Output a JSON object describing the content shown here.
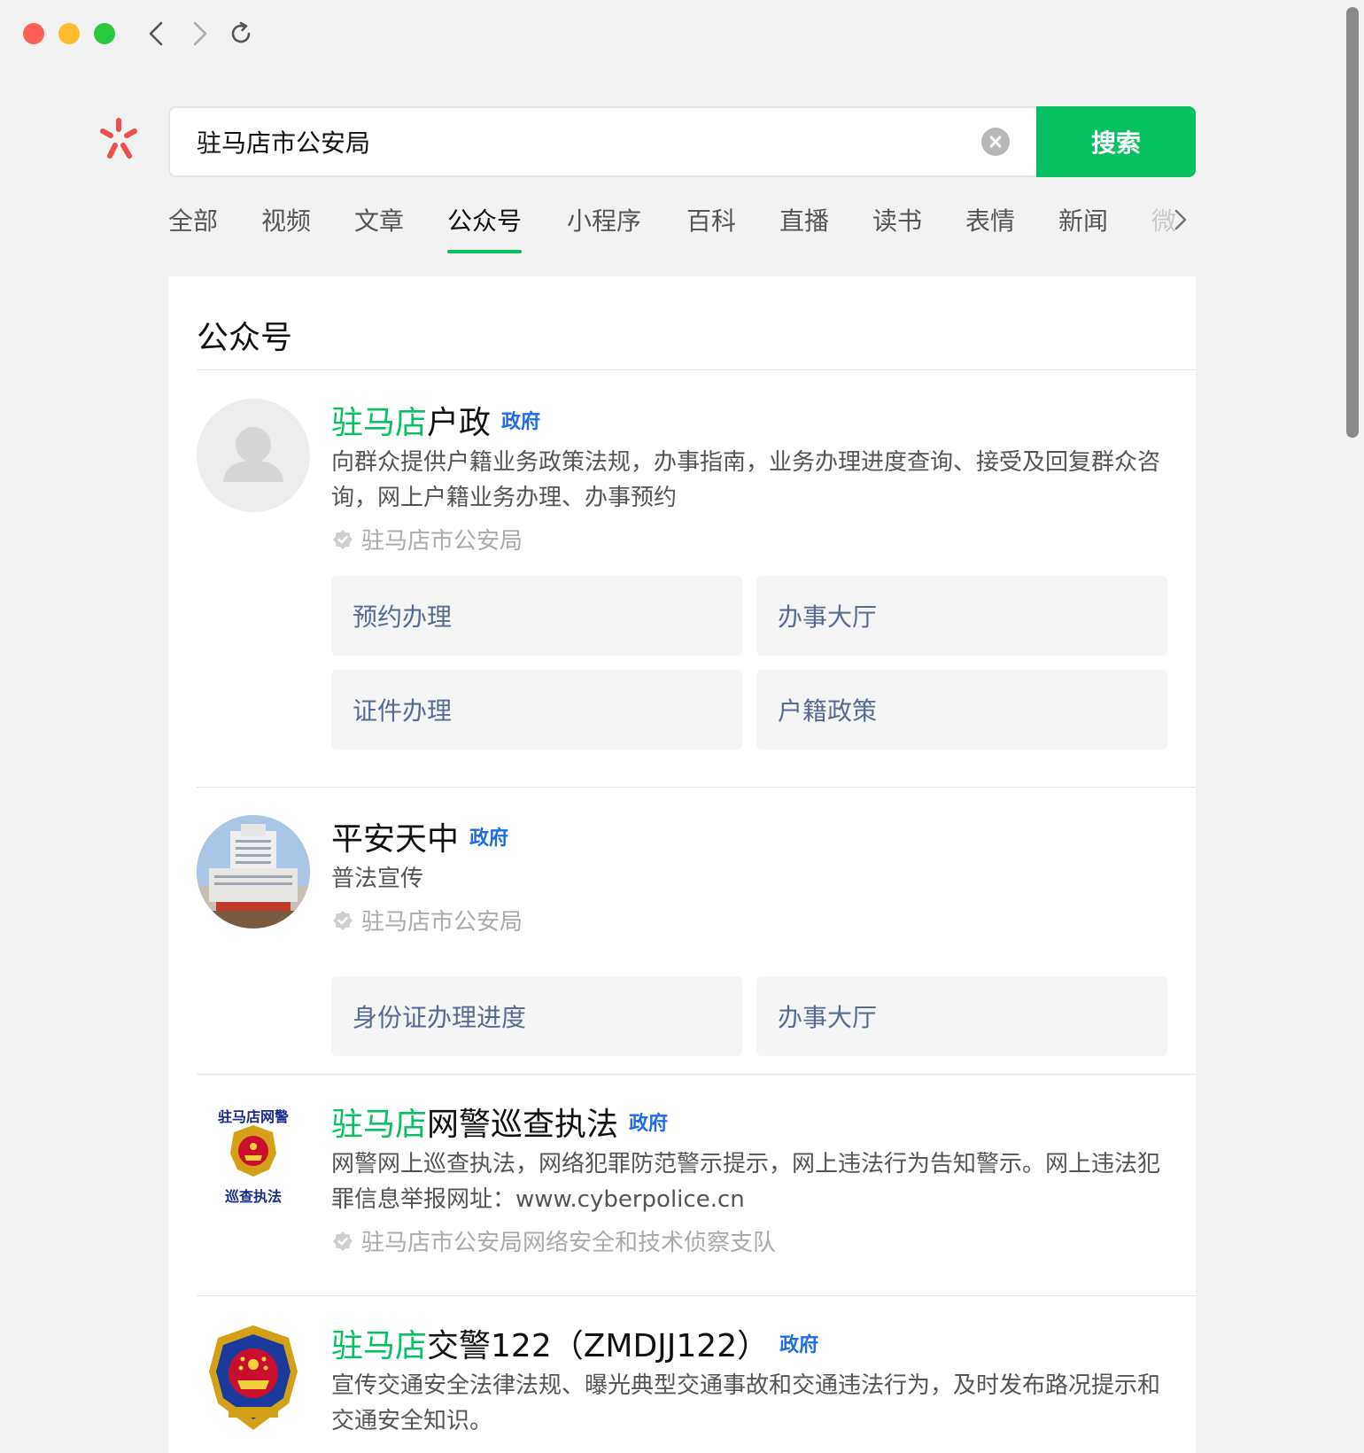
{
  "window": {
    "nav": {
      "back": "back-icon",
      "forward": "forward-icon",
      "reload": "reload-icon"
    }
  },
  "search": {
    "query": "驻马店市公安局",
    "button_label": "搜索"
  },
  "tabs": [
    "全部",
    "视频",
    "文章",
    "公众号",
    "小程序",
    "百科",
    "直播",
    "读书",
    "表情",
    "新闻",
    "微"
  ],
  "active_tab": "公众号",
  "section_title": "公众号",
  "results": [
    {
      "name_highlight": "驻马店",
      "name_rest": "户政",
      "badge": "政府",
      "description": "向群众提供户籍业务政策法规，办事指南，业务办理进度查询、接受及回复群众咨询，网上户籍业务办理、办事预约",
      "verified_by": "驻马店市公安局",
      "menu": [
        "预约办理",
        "办事大厅",
        "证件办理",
        "户籍政策"
      ]
    },
    {
      "name_highlight": "",
      "name_rest": "平安天中",
      "badge": "政府",
      "description": "普法宣传",
      "verified_by": "驻马店市公安局",
      "menu": [
        "身份证办理进度",
        "办事大厅"
      ]
    },
    {
      "name_highlight": "驻马店",
      "name_rest": "网警巡查执法",
      "badge": "政府",
      "description": "网警网上巡查执法，网络犯罪防范警示提示，网上违法行为告知警示。网上违法犯罪信息举报网址：www.cyberpolice.cn",
      "verified_by": "驻马店市公安局网络安全和技术侦察支队",
      "avatar_text_top": "驻马店网警",
      "avatar_text_bottom": "巡查执法"
    },
    {
      "name_highlight": "驻马店",
      "name_rest": "交警122（ZMDJJ122）",
      "badge": "政府",
      "description": "宣传交通安全法律法规、曝光典型交通事故和交通违法行为，及时发布路况提示和交通安全知识。"
    }
  ],
  "colors": {
    "accent": "#07c160",
    "badge": "#1e6ce6",
    "menu_text": "#576b95"
  }
}
